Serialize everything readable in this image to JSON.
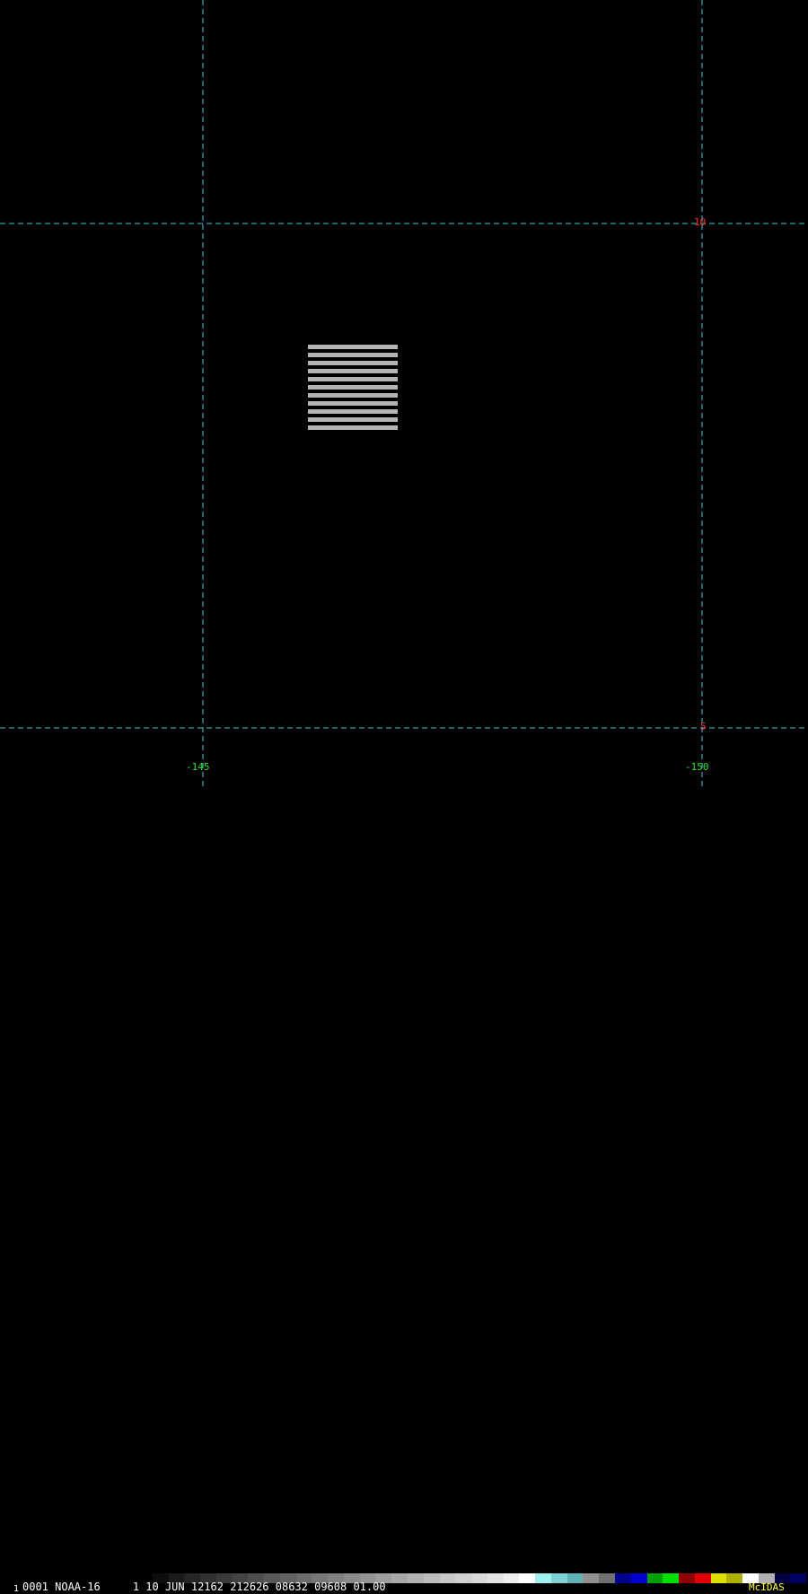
{
  "grid": {
    "line_color": "#3fc8d8",
    "lat_label_color": "#ff3030",
    "lon_label_color": "#30e030",
    "lat_labels": [
      "10",
      "5"
    ],
    "lon_labels": [
      "-145",
      "-150"
    ]
  },
  "swath": {
    "stripe_color": "#b4b4b4",
    "gap_color": "#000000"
  },
  "status": {
    "frame_marker": "1",
    "info_text": "0001 NOAA-16     1 10 JUN 12162 212626 08632 09608 01.00",
    "brand": "McIDAS",
    "brand_color": "#ffff40",
    "colorbar": [
      "#000000",
      "#0d0d0d",
      "#1a1a1a",
      "#262626",
      "#303030",
      "#3a3a3a",
      "#444444",
      "#4e4e4e",
      "#585858",
      "#626262",
      "#6c6c6c",
      "#767676",
      "#808080",
      "#8a8a8a",
      "#949494",
      "#9e9e9e",
      "#a8a8a8",
      "#b2b2b2",
      "#bcbcbc",
      "#c6c6c6",
      "#d0d0d0",
      "#dadada",
      "#e4e4e4",
      "#eeeeee",
      "#ffffff",
      "#a0f0f0",
      "#80d0d8",
      "#60b0b8",
      "#909090",
      "#707070",
      "#000090",
      "#0000d0",
      "#00a000",
      "#00e000",
      "#900000",
      "#e00000",
      "#e0e000",
      "#b0b000",
      "#ffffff",
      "#b0b0b0",
      "#000040",
      "#000060"
    ]
  }
}
